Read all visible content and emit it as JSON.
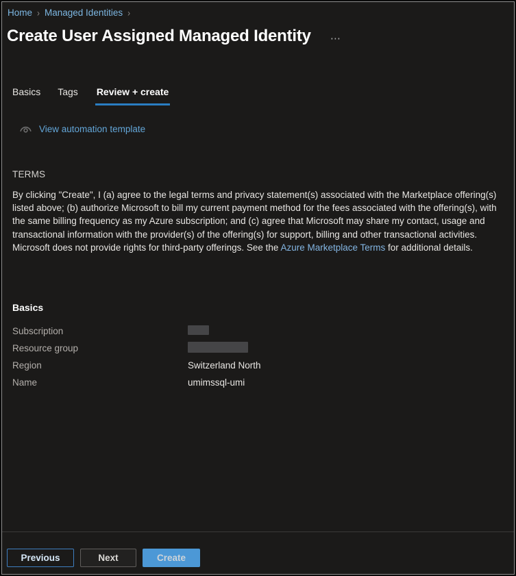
{
  "breadcrumb": {
    "separator": "›",
    "items": [
      {
        "label": "Home"
      },
      {
        "label": "Managed Identities"
      }
    ]
  },
  "header": {
    "title": "Create User Assigned Managed Identity",
    "more_options": "⋯"
  },
  "tabs": [
    {
      "label": "Basics",
      "active": false
    },
    {
      "label": "Tags",
      "active": false
    },
    {
      "label": "Review + create",
      "active": true
    }
  ],
  "automation_link": {
    "icon": "eye-icon",
    "label": "View automation template"
  },
  "terms": {
    "heading": "TERMS",
    "body_before_link": "By clicking \"Create\", I (a) agree to the legal terms and privacy statement(s) associated with the Marketplace offering(s) listed above; (b) authorize Microsoft to bill my current payment method for the fees associated with the offering(s), with the same billing frequency as my Azure subscription; and (c) agree that Microsoft may share my contact, usage and transactional information with the provider(s) of the offering(s) for support, billing and other transactional activities. Microsoft does not provide rights for third-party offerings. See the ",
    "link_text": "Azure Marketplace Terms",
    "body_after_link": " for additional details."
  },
  "summary": {
    "heading": "Basics",
    "rows": [
      {
        "label": "Subscription",
        "value": "",
        "redacted": true
      },
      {
        "label": "Resource group",
        "value": "",
        "redacted": true
      },
      {
        "label": "Region",
        "value": "Switzerland North",
        "redacted": false
      },
      {
        "label": "Name",
        "value": "umimssql-umi",
        "redacted": false
      }
    ]
  },
  "footer": {
    "previous_label": "Previous",
    "next_label": "Next",
    "create_label": "Create"
  },
  "colors": {
    "background": "#1b1a19",
    "accent_tab_underline": "#2a7dc2",
    "breadcrumb_link": "#7db7e2",
    "body_link": "#83b5e2",
    "automation_link": "#63a6d8",
    "create_button_bg": "#4c98d6",
    "previous_button_border": "#3f7fc1"
  }
}
